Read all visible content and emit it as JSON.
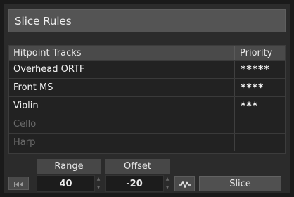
{
  "panel": {
    "title": "Slice Rules"
  },
  "table": {
    "headers": {
      "tracks": "Hitpoint Tracks",
      "priority": "Priority"
    },
    "rows": [
      {
        "name": "Overhead ORTF",
        "priority": "*****",
        "active": true
      },
      {
        "name": "Front MS",
        "priority": "****",
        "active": true
      },
      {
        "name": "Violin",
        "priority": "***",
        "active": true
      },
      {
        "name": "Cello",
        "priority": "",
        "active": false
      },
      {
        "name": "Harp",
        "priority": "",
        "active": false
      }
    ]
  },
  "controls": {
    "range": {
      "label": "Range",
      "value": "40"
    },
    "offset": {
      "label": "Offset",
      "value": "-20"
    },
    "slice_button": "Slice",
    "skip_icon": "skip-to-start-icon",
    "waveform_icon": "waveform-icon"
  }
}
